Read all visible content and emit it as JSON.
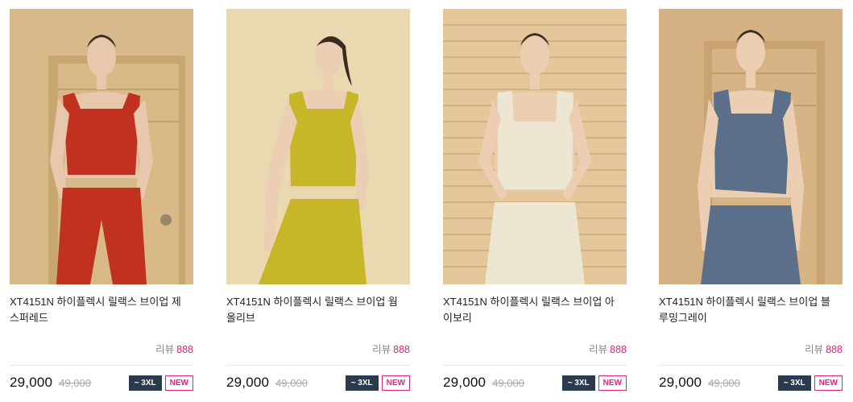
{
  "products": [
    {
      "name": "XT4151N 하이플렉시 릴랙스 브이업 제스퍼레드",
      "review_label": "리뷰",
      "review_count": "888",
      "price": "29,000",
      "original_price": "49,000",
      "size_badge": "~ 3XL",
      "new_badge": "NEW",
      "color_hex": "#c0311f",
      "bg_hex": "#d9b88a"
    },
    {
      "name": "XT4151N 하이플렉시 릴랙스 브이업 웜올리브",
      "review_label": "리뷰",
      "review_count": "888",
      "price": "29,000",
      "original_price": "49,000",
      "size_badge": "~ 3XL",
      "new_badge": "NEW",
      "color_hex": "#c7b52a",
      "bg_hex": "#e8d6ad"
    },
    {
      "name": "XT4151N 하이플렉시 릴랙스 브이업 아이보리",
      "review_label": "리뷰",
      "review_count": "888",
      "price": "29,000",
      "original_price": "49,000",
      "size_badge": "~ 3XL",
      "new_badge": "NEW",
      "color_hex": "#ece6d3",
      "bg_hex": "#e4c89c"
    },
    {
      "name": "XT4151N 하이플렉시 릴랙스 브이업 블루밍그레이",
      "review_label": "리뷰",
      "review_count": "888",
      "price": "29,000",
      "original_price": "49,000",
      "size_badge": "~ 3XL",
      "new_badge": "NEW",
      "color_hex": "#5b6f8a",
      "bg_hex": "#d4b082"
    }
  ],
  "colors": {
    "accent": "#e0257e",
    "badge_dark": "#2c3a4d"
  }
}
